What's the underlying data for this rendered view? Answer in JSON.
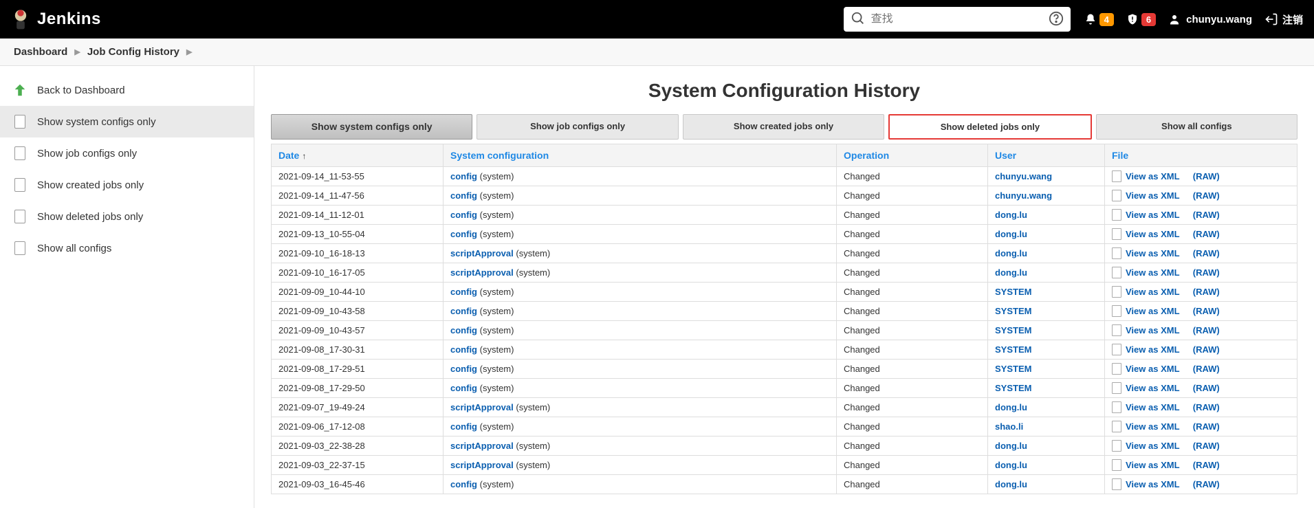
{
  "header": {
    "logo_text": "Jenkins",
    "search_placeholder": "查找",
    "badge_notif": "4",
    "badge_alert": "6",
    "username": "chunyu.wang",
    "logout": "注销"
  },
  "breadcrumb": {
    "dashboard": "Dashboard",
    "page": "Job Config History"
  },
  "sidebar": [
    {
      "label": "Back to Dashboard",
      "icon": "arrow-up",
      "name": "back-to-dashboard"
    },
    {
      "label": "Show system configs only",
      "icon": "doc-gear",
      "name": "show-system-configs",
      "active": true
    },
    {
      "label": "Show job configs only",
      "icon": "doc-gear",
      "name": "show-job-configs"
    },
    {
      "label": "Show created jobs only",
      "icon": "doc-gear",
      "name": "show-created-jobs"
    },
    {
      "label": "Show deleted jobs only",
      "icon": "doc-gear",
      "name": "show-deleted-jobs"
    },
    {
      "label": "Show all configs",
      "icon": "doc",
      "name": "show-all-configs"
    }
  ],
  "page_title": "System Configuration History",
  "filters": [
    {
      "label": "Show system configs only",
      "state": "active"
    },
    {
      "label": "Show job configs only",
      "state": ""
    },
    {
      "label": "Show created jobs only",
      "state": ""
    },
    {
      "label": "Show deleted jobs only",
      "state": "highlighted"
    },
    {
      "label": "Show all configs",
      "state": ""
    }
  ],
  "table": {
    "headers": {
      "date": "Date",
      "config": "System configuration",
      "op": "Operation",
      "user": "User",
      "file": "File"
    },
    "sort_arrow": "↑",
    "file_links": {
      "xml": "View as XML",
      "raw": "(RAW)"
    },
    "suffix": "(system)"
  },
  "rows": [
    {
      "date": "2021-09-14_11-53-55",
      "cfg": "config",
      "op": "Changed",
      "user": "chunyu.wang"
    },
    {
      "date": "2021-09-14_11-47-56",
      "cfg": "config",
      "op": "Changed",
      "user": "chunyu.wang"
    },
    {
      "date": "2021-09-14_11-12-01",
      "cfg": "config",
      "op": "Changed",
      "user": "dong.lu"
    },
    {
      "date": "2021-09-13_10-55-04",
      "cfg": "config",
      "op": "Changed",
      "user": "dong.lu"
    },
    {
      "date": "2021-09-10_16-18-13",
      "cfg": "scriptApproval",
      "op": "Changed",
      "user": "dong.lu"
    },
    {
      "date": "2021-09-10_16-17-05",
      "cfg": "scriptApproval",
      "op": "Changed",
      "user": "dong.lu"
    },
    {
      "date": "2021-09-09_10-44-10",
      "cfg": "config",
      "op": "Changed",
      "user": "SYSTEM"
    },
    {
      "date": "2021-09-09_10-43-58",
      "cfg": "config",
      "op": "Changed",
      "user": "SYSTEM"
    },
    {
      "date": "2021-09-09_10-43-57",
      "cfg": "config",
      "op": "Changed",
      "user": "SYSTEM"
    },
    {
      "date": "2021-09-08_17-30-31",
      "cfg": "config",
      "op": "Changed",
      "user": "SYSTEM"
    },
    {
      "date": "2021-09-08_17-29-51",
      "cfg": "config",
      "op": "Changed",
      "user": "SYSTEM"
    },
    {
      "date": "2021-09-08_17-29-50",
      "cfg": "config",
      "op": "Changed",
      "user": "SYSTEM"
    },
    {
      "date": "2021-09-07_19-49-24",
      "cfg": "scriptApproval",
      "op": "Changed",
      "user": "dong.lu"
    },
    {
      "date": "2021-09-06_17-12-08",
      "cfg": "config",
      "op": "Changed",
      "user": "shao.li"
    },
    {
      "date": "2021-09-03_22-38-28",
      "cfg": "scriptApproval",
      "op": "Changed",
      "user": "dong.lu"
    },
    {
      "date": "2021-09-03_22-37-15",
      "cfg": "scriptApproval",
      "op": "Changed",
      "user": "dong.lu"
    },
    {
      "date": "2021-09-03_16-45-46",
      "cfg": "config",
      "op": "Changed",
      "user": "dong.lu"
    }
  ]
}
